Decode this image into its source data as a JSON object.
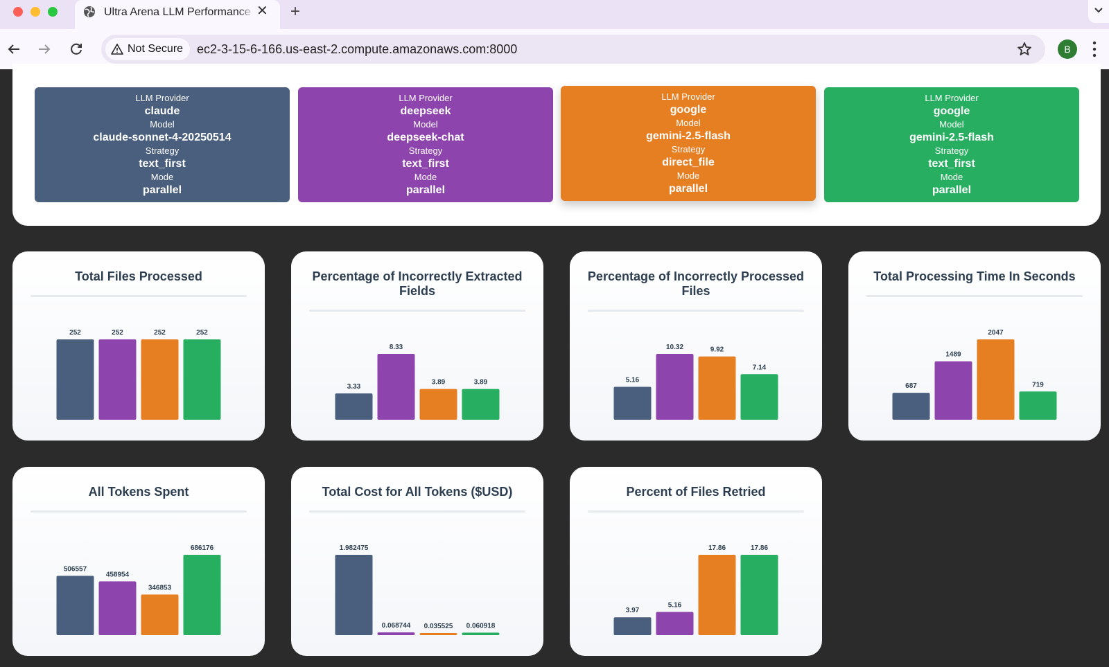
{
  "browser": {
    "tab_title": "Ultra Arena LLM Performance",
    "security_label": "Not Secure",
    "url": "ec2-3-15-6-166.us-east-2.compute.amazonaws.com:8000",
    "profile_initial": "B"
  },
  "field_labels": {
    "provider": "LLM Provider",
    "model": "Model",
    "strategy": "Strategy",
    "mode": "Mode"
  },
  "configs": [
    {
      "provider": "claude",
      "model": "claude-sonnet-4-20250514",
      "strategy": "text_first",
      "mode": "parallel",
      "color": "#4a5f7d"
    },
    {
      "provider": "deepseek",
      "model": "deepseek-chat",
      "strategy": "text_first",
      "mode": "parallel",
      "color": "#8e44ad"
    },
    {
      "provider": "google",
      "model": "gemini-2.5-flash",
      "strategy": "direct_file",
      "mode": "parallel",
      "color": "#e67e22"
    },
    {
      "provider": "google",
      "model": "gemini-2.5-flash",
      "strategy": "text_first",
      "mode": "parallel",
      "color": "#27ae60"
    }
  ],
  "chart_data": [
    {
      "type": "bar",
      "title": "Total Files Processed",
      "values": [
        252,
        252,
        252,
        252
      ],
      "labels": [
        "252",
        "252",
        "252",
        "252"
      ]
    },
    {
      "type": "bar",
      "title": "Percentage of Incorrectly Extracted Fields",
      "values": [
        3.33,
        8.33,
        3.89,
        3.89
      ],
      "labels": [
        "3.33",
        "8.33",
        "3.89",
        "3.89"
      ]
    },
    {
      "type": "bar",
      "title": "Percentage of Incorrectly Processed Files",
      "values": [
        5.16,
        10.32,
        9.92,
        7.14
      ],
      "labels": [
        "5.16",
        "10.32",
        "9.92",
        "7.14"
      ]
    },
    {
      "type": "bar",
      "title": "Total Processing Time In Seconds",
      "values": [
        687,
        1489,
        2047,
        719
      ],
      "labels": [
        "687",
        "1489",
        "2047",
        "719"
      ]
    },
    {
      "type": "bar",
      "title": "All Tokens Spent",
      "values": [
        506557,
        458954,
        346853,
        686176
      ],
      "labels": [
        "506557",
        "458954",
        "346853",
        "686176"
      ]
    },
    {
      "type": "bar",
      "title": "Total Cost for All Tokens ($USD)",
      "values": [
        1.982475,
        0.068744,
        0.035525,
        0.060918
      ],
      "labels": [
        "1.982475",
        "0.068744",
        "0.035525",
        "0.060918"
      ]
    },
    {
      "type": "bar",
      "title": "Percent of Files Retried",
      "values": [
        3.97,
        5.16,
        17.86,
        17.86
      ],
      "labels": [
        "3.97",
        "5.16",
        "17.86",
        "17.86"
      ]
    }
  ]
}
